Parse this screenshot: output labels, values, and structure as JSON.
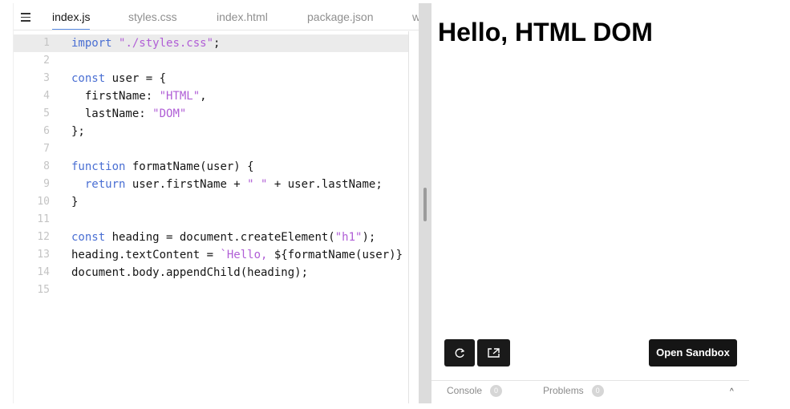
{
  "tabs": [
    {
      "label": "index.js",
      "active": true
    },
    {
      "label": "styles.css",
      "active": false
    },
    {
      "label": "index.html",
      "active": false
    },
    {
      "label": "package.json",
      "active": false
    },
    {
      "label": "w",
      "active": false
    }
  ],
  "code": {
    "line_numbers": [
      "1",
      "2",
      "3",
      "4",
      "5",
      "6",
      "7",
      "8",
      "9",
      "10",
      "11",
      "12",
      "13",
      "14",
      "15"
    ],
    "lines": [
      [
        {
          "t": "import",
          "c": "kw"
        },
        {
          "t": " "
        },
        {
          "t": "\"./styles.css\"",
          "c": "str"
        },
        {
          "t": ";"
        }
      ],
      [],
      [
        {
          "t": "const",
          "c": "kw"
        },
        {
          "t": " user = {"
        }
      ],
      [
        {
          "t": "  firstName: "
        },
        {
          "t": "\"HTML\"",
          "c": "str"
        },
        {
          "t": ","
        }
      ],
      [
        {
          "t": "  lastName: "
        },
        {
          "t": "\"DOM\"",
          "c": "str"
        }
      ],
      [
        {
          "t": "};"
        }
      ],
      [],
      [
        {
          "t": "function",
          "c": "kw"
        },
        {
          "t": " formatName(user) {"
        }
      ],
      [
        {
          "t": "  "
        },
        {
          "t": "return",
          "c": "kw"
        },
        {
          "t": " user.firstName + "
        },
        {
          "t": "\" \"",
          "c": "str"
        },
        {
          "t": " + user.lastName;"
        }
      ],
      [
        {
          "t": "}"
        }
      ],
      [],
      [
        {
          "t": "const",
          "c": "kw"
        },
        {
          "t": " heading = document.createElement("
        },
        {
          "t": "\"h1\"",
          "c": "str"
        },
        {
          "t": ");"
        }
      ],
      [
        {
          "t": "heading.textContent = "
        },
        {
          "t": "`Hello, ",
          "c": "str"
        },
        {
          "t": "${formatName(user)}"
        }
      ],
      [
        {
          "t": "document.body.appendChild(heading);"
        }
      ],
      []
    ],
    "highlighted_line": 1
  },
  "preview": {
    "heading": "Hello, HTML DOM",
    "refresh_icon": "refresh-icon",
    "open_new_icon": "open-new-window-icon",
    "open_sandbox_label": "Open Sandbox"
  },
  "console_bar": {
    "console_label": "Console",
    "console_count": "0",
    "problems_label": "Problems",
    "problems_count": "0",
    "collapse_icon": "chevron-up-icon"
  }
}
